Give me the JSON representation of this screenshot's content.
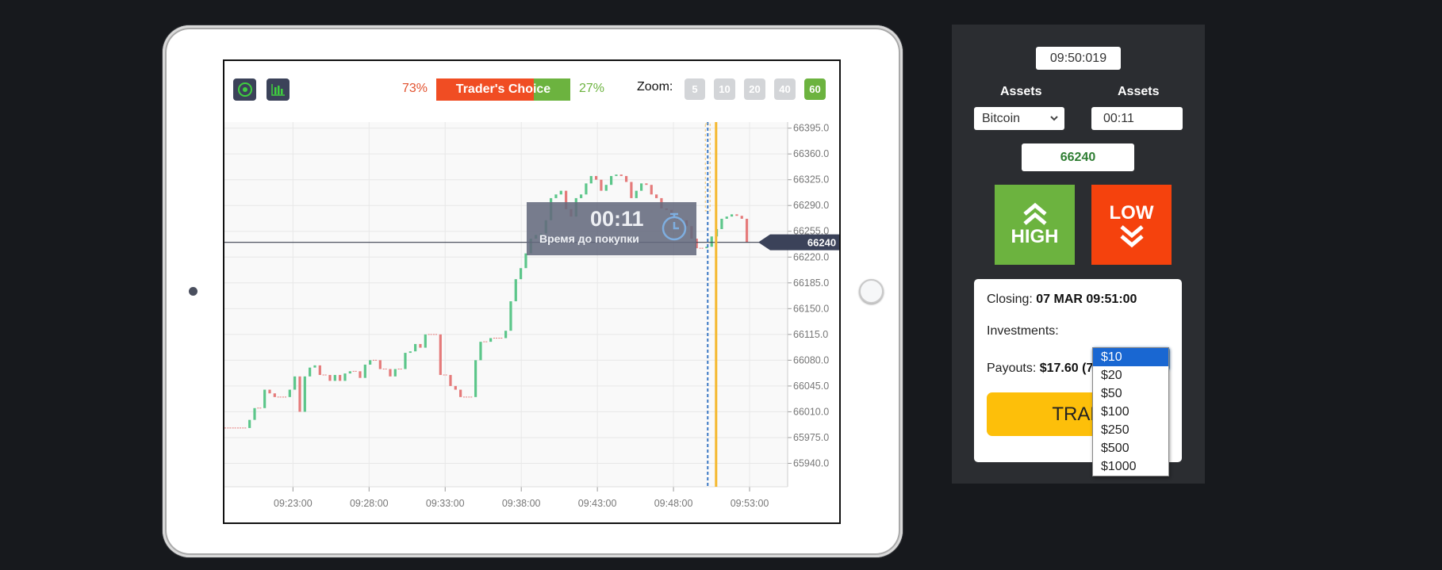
{
  "chart": {
    "left_tool_icons": [
      "target-icon",
      "bar-chart-icon"
    ],
    "traders_choice": {
      "label": "Trader's Choice",
      "up_pct": "73%",
      "down_pct": "27%",
      "up_fraction": 0.73,
      "colors": {
        "red": "#f04d23",
        "green": "#6cb33f"
      }
    },
    "zoom": {
      "label": "Zoom:",
      "options": [
        "5",
        "10",
        "20",
        "40",
        "60"
      ],
      "active": "60"
    },
    "timer_overlay": {
      "time": "00:11",
      "subtitle": "Время до покупки"
    },
    "current_price_tag": "66240"
  },
  "chart_data": {
    "type": "candlestick",
    "title": "",
    "xlabel": "",
    "ylabel": "",
    "y_ticks": [
      66395.0,
      66360.0,
      66325.0,
      66290.0,
      66255.0,
      66220.0,
      66185.0,
      66150.0,
      66115.0,
      66080.0,
      66045.0,
      66010.0,
      65975.0,
      65940.0
    ],
    "y_tick_labels": [
      "66395.0",
      "66360.0",
      "66325.0",
      "66290.0",
      "66255.0",
      "66220.0",
      "66185.0",
      "66150.0",
      "66115.0",
      "66080.0",
      "66045.0",
      "66010.0",
      "65975.0",
      "65940.0"
    ],
    "ylim": [
      65905,
      66400
    ],
    "x_ticks_min": [
      23,
      28,
      33,
      38,
      43,
      48,
      53
    ],
    "x_tick_labels": [
      "09:23:00",
      "09:28:00",
      "09:33:00",
      "09:38:00",
      "09:43:00",
      "09:48:00",
      "09:53:00"
    ],
    "xlim_min": [
      18.5,
      55.5
    ],
    "grid": true,
    "current_price": 66240,
    "purchase_deadline_min": 50.25,
    "expiry_min": 50.8,
    "candle_step_min": 0.33,
    "start_min": 18.5,
    "closes": [
      65988,
      65988,
      65988,
      65988,
      65988,
      65999,
      66015,
      66015,
      66040,
      66035,
      66030,
      66030,
      66030,
      66040,
      66058,
      66010,
      66058,
      66070,
      66073,
      66060,
      66060,
      66052,
      66060,
      66052,
      66062,
      66065,
      66065,
      66056,
      66074,
      66080,
      66080,
      66068,
      66068,
      66058,
      66068,
      66068,
      66090,
      66092,
      66102,
      66097,
      66115,
      66115,
      66115,
      66060,
      66060,
      66045,
      66040,
      66030,
      66030,
      66030,
      66080,
      66105,
      66105,
      66110,
      66110,
      66110,
      66120,
      66160,
      66190,
      66205,
      66225,
      66245,
      66250,
      66252,
      66270,
      66300,
      66305,
      66310,
      66285,
      66275,
      66300,
      66305,
      66320,
      66330,
      66325,
      66310,
      66318,
      66330,
      66332,
      66330,
      66322,
      66300,
      66310,
      66320,
      66318,
      66305,
      66300,
      66286,
      66284,
      66272,
      66272,
      66270,
      66262,
      66245,
      66232,
      66232,
      66234,
      66248,
      66258,
      66272,
      66275,
      66278,
      66276,
      66272,
      66240
    ]
  },
  "panel": {
    "clock": "09:50:019",
    "asset_label_1": "Assets",
    "asset_label_2": "Assets",
    "asset_select": "Bitcoin",
    "countdown": "00:11",
    "price": "66240",
    "high_label": "HIGH",
    "low_label": "LOW",
    "colors": {
      "high": "#6cb33f",
      "low": "#f5420d",
      "price": "#2e7d32"
    },
    "closing_label": "Closing:",
    "closing_value": "07 MAR 09:51:00",
    "investments_label": "Investments:",
    "investment_selected": "$10",
    "investment_options": [
      "$10",
      "$20",
      "$50",
      "$100",
      "$250",
      "$500",
      "$1000"
    ],
    "payouts_label": "Payouts:",
    "payouts_value": "$17.60 (7",
    "trade_label": "TRAD"
  }
}
